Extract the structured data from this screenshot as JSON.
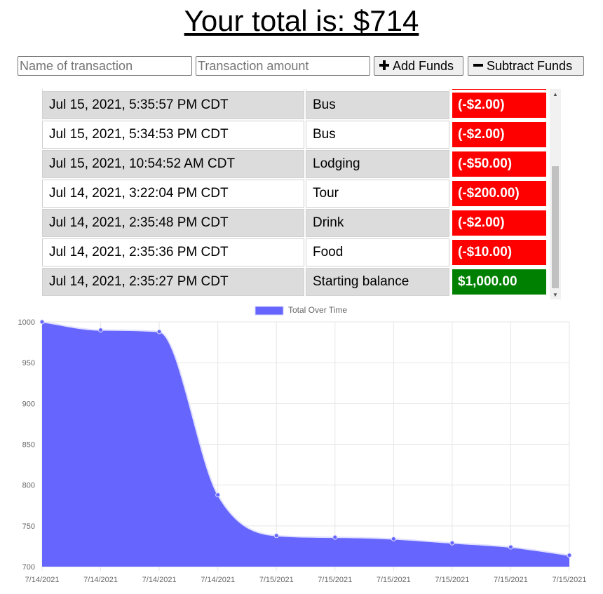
{
  "header": {
    "total_text": "Your total is: $714"
  },
  "form": {
    "name_placeholder": "Name of transaction",
    "amount_placeholder": "Transaction amount",
    "add_label": "Add Funds",
    "subtract_label": "Subtract Funds"
  },
  "transactions": [
    {
      "date": "Jul 15, 2021, 5:35:57 PM CDT",
      "name": "Bus",
      "amount": "(-$2.00)"
    },
    {
      "date": "Jul 15, 2021, 5:34:53 PM CDT",
      "name": "Bus",
      "amount": "(-$2.00)"
    },
    {
      "date": "Jul 15, 2021, 10:54:52 AM CDT",
      "name": "Lodging",
      "amount": "(-$50.00)"
    },
    {
      "date": "Jul 14, 2021, 3:22:04 PM CDT",
      "name": "Tour",
      "amount": "(-$200.00)"
    },
    {
      "date": "Jul 14, 2021, 2:35:48 PM CDT",
      "name": "Drink",
      "amount": "(-$2.00)"
    },
    {
      "date": "Jul 14, 2021, 2:35:36 PM CDT",
      "name": "Food",
      "amount": "(-$10.00)"
    },
    {
      "date": "Jul 14, 2021, 2:35:27 PM CDT",
      "name": "Starting balance",
      "amount": "$1,000.00"
    }
  ],
  "colors": {
    "negative": "#ff0000",
    "positive": "#008000",
    "series_fill": "#6666ff",
    "series_line": "#e0e0ff"
  },
  "chart_data": {
    "type": "area",
    "title": "",
    "xlabel": "",
    "ylabel": "",
    "legend": "top-center",
    "grid": true,
    "ylim": [
      700,
      1000
    ],
    "yticks": [
      1000,
      950,
      900,
      850,
      800,
      750,
      700
    ],
    "x": [
      "7/14/2021",
      "7/14/2021",
      "7/14/2021",
      "7/14/2021",
      "7/15/2021",
      "7/15/2021",
      "7/15/2021",
      "7/15/2021",
      "7/15/2021",
      "7/15/2021"
    ],
    "series": [
      {
        "name": "Total Over Time",
        "values": [
          1000,
          990,
          988,
          788,
          738,
          736,
          734,
          729,
          724,
          714
        ]
      }
    ]
  }
}
